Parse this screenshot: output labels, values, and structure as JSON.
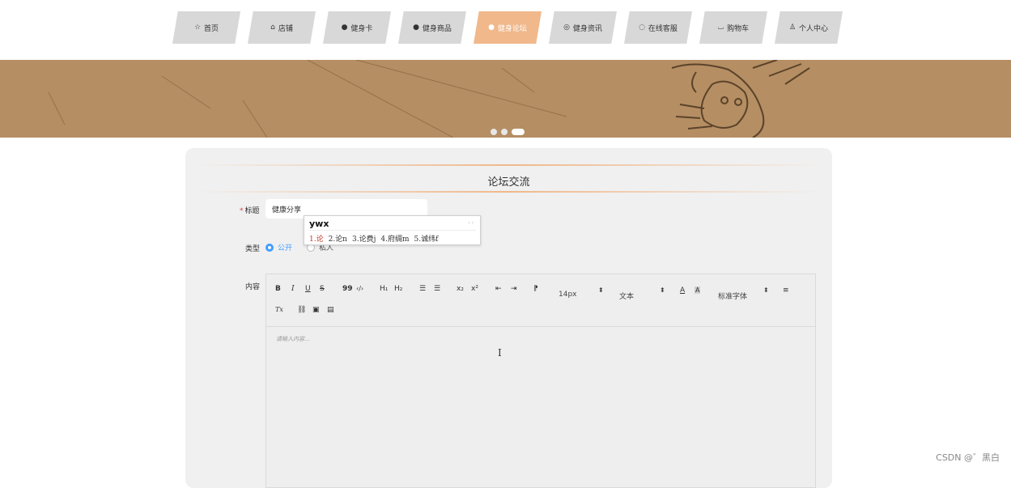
{
  "nav": {
    "items": [
      {
        "label": "首页",
        "icon": "☆"
      },
      {
        "label": "店铺",
        "icon": "⌂"
      },
      {
        "label": "健身卡",
        "icon": "●"
      },
      {
        "label": "健身商品",
        "icon": "●"
      },
      {
        "label": "健身论坛",
        "icon": "●"
      },
      {
        "label": "健身资讯",
        "icon": "◎"
      },
      {
        "label": "在线客服",
        "icon": "◌"
      },
      {
        "label": "购物车",
        "icon": "⌴"
      },
      {
        "label": "个人中心",
        "icon": "♙"
      }
    ],
    "active_index": 4,
    "active_color": "#f0b88b"
  },
  "banner": {
    "background": "#b08a60",
    "dots_count": 3,
    "active_dot": 2
  },
  "panel": {
    "title": "论坛交流"
  },
  "form": {
    "title_label": "标题",
    "required_mark": "*",
    "title_value": "健康分享",
    "type_label": "类型",
    "type_options": [
      "公开",
      "私人"
    ],
    "type_selected": "公开",
    "content_label": "内容"
  },
  "ime": {
    "composition": "ywx",
    "arrows": "‹ ›",
    "candidates": [
      "1.论",
      "2.论n",
      "3.论费j",
      "4.府绸m",
      "5.诚纬f"
    ]
  },
  "editor": {
    "toolbar": {
      "bold": "B",
      "italic": "I",
      "underline": "U",
      "strike": "S",
      "blockquote": "99",
      "code": "‹/›",
      "h1": "H₁",
      "h2": "H₂",
      "ordered_list": "☰",
      "bullet_list": "☰",
      "subscript": "x₂",
      "superscript": "x²",
      "outdent": "⇤",
      "indent": "⇥",
      "direction": "⁋",
      "font_size": "14px",
      "text_type": "文本",
      "color": "A",
      "background": "A",
      "font_family": "标准字体",
      "align": "≡",
      "clean": "Tx",
      "link": "⛓",
      "image": "▣",
      "video": "▤"
    },
    "placeholder": "请输入内容..."
  },
  "watermark": "CSDN @゛黑白"
}
